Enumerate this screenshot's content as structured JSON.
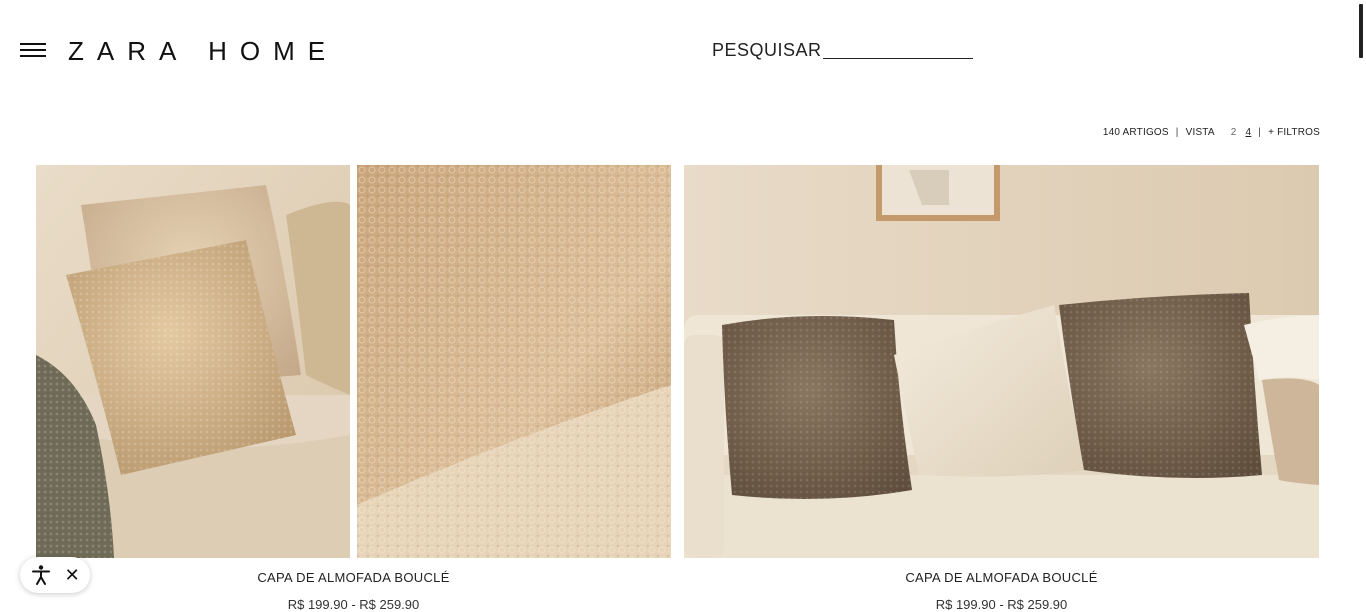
{
  "header": {
    "logo": "ZARA HOME",
    "search_label": "PESQUISAR"
  },
  "toolbar": {
    "count": "140 ARTIGOS",
    "sep1": "|",
    "view_label": "VISTA",
    "view_2": "2",
    "view_4": "4",
    "sep2": "|",
    "filters": "+ FILTROS"
  },
  "products": [
    {
      "title": "CAPA DE ALMOFADA BOUCLÉ",
      "price": "R$ 199.90 - R$ 259.90"
    },
    {
      "title": "CAPA DE ALMOFADA BOUCLÉ",
      "price": "R$ 199.90 - R$ 259.90"
    }
  ],
  "icons": {
    "menu": "hamburger-icon",
    "accessibility": "accessibility-icon",
    "close": "close-icon"
  },
  "colors": {
    "page_bg": "#ffffff",
    "text": "#111111",
    "beige": "#d9c2a2",
    "taupe": "#7a6651"
  }
}
